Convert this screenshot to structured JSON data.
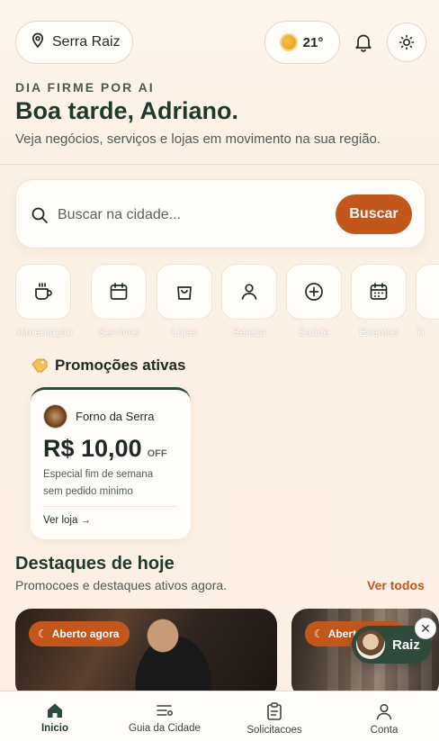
{
  "header": {
    "location": "Serra Raiz",
    "temperature": "21°",
    "eyebrow": "DIA FIRME POR AI",
    "greeting": "Boa tarde, Adriano.",
    "subtitle": "Veja negócios, serviços e lojas em movimento na sua região."
  },
  "search": {
    "placeholder": "Buscar na cidade...",
    "button": "Buscar"
  },
  "categories": [
    {
      "label": "Alimentação",
      "icon": "coffee-cup-icon"
    },
    {
      "label": "Serviços",
      "icon": "calendar-icon"
    },
    {
      "label": "Lojas",
      "icon": "shopping-bag-icon"
    },
    {
      "label": "Beleza",
      "icon": "person-icon"
    },
    {
      "label": "Saúde",
      "icon": "plus-circle-icon"
    },
    {
      "label": "Eventos",
      "icon": "calendar-grid-icon"
    },
    {
      "label": "Tr",
      "icon": "truncated-icon"
    }
  ],
  "promos": {
    "title": "Promoções ativas",
    "card": {
      "store": "Forno da Serra",
      "price": "R$ 10,00",
      "off": "OFF",
      "description_1": "Especial fim de semana",
      "description_2": "sem pedido minimo",
      "link": "Ver loja →"
    }
  },
  "highlights": {
    "title": "Destaques de hoje",
    "subtitle": "Promocoes e destaques ativos agora.",
    "see_all": "Ver todos",
    "cards": [
      {
        "badge": "Aberto agora"
      },
      {
        "badge": "Aberto agora"
      }
    ]
  },
  "assistant": {
    "label": "Raiz",
    "close": "✕"
  },
  "nav": [
    {
      "label": "Inicio",
      "icon": "home-icon",
      "active": true
    },
    {
      "label": "Guia da Cidade",
      "icon": "guide-list-icon",
      "active": false
    },
    {
      "label": "Solicitacoes",
      "icon": "clipboard-icon",
      "active": false
    },
    {
      "label": "Conta",
      "icon": "user-icon",
      "active": false
    }
  ],
  "colors": {
    "accent": "#c2561b",
    "primary": "#2d4a3a",
    "background": "#fbf1e4"
  }
}
